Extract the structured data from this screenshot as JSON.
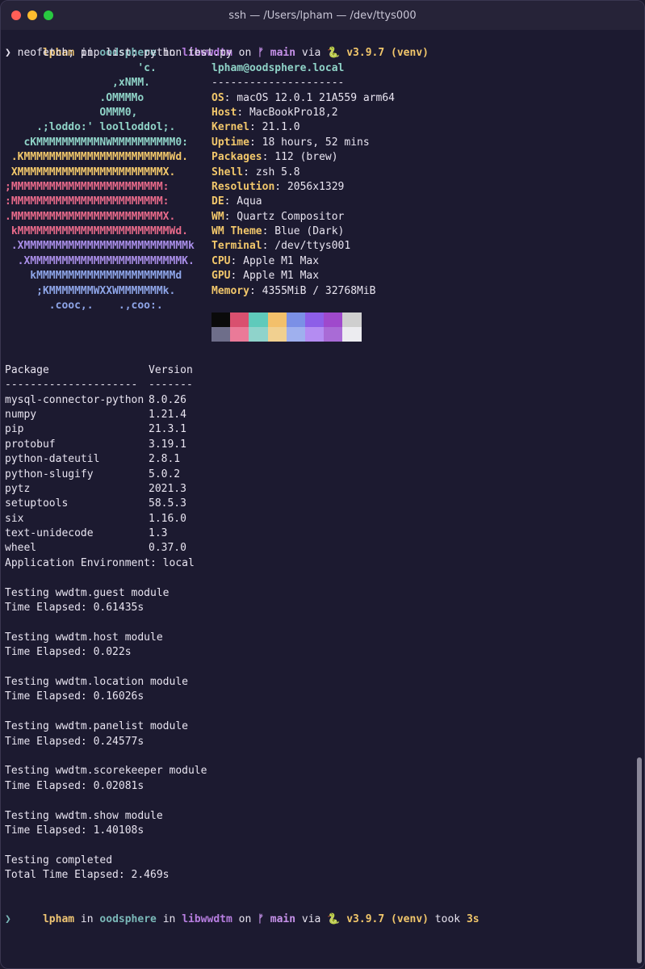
{
  "window": {
    "title": "ssh — /Users/lpham — /dev/ttys000",
    "lights": [
      "#ff5f57",
      "#febc2e",
      "#28c840"
    ]
  },
  "colors": {
    "user": "#f0c674",
    "host": "#7ab8b8",
    "dir": "#b77ee0",
    "branch": "#c792ea",
    "python": "#f2c76b",
    "label": "#f2c76b",
    "userhost": "#8fd3c7"
  },
  "prompt1": {
    "user": "lpham",
    "in1": " in ",
    "host": "oodsphere",
    "in2": " in ",
    "dir": "libwwdtm",
    "on": " on ",
    "branch_icon": "ᚠ",
    "branch": " main",
    "via": " via ",
    "python_icon": "🐍",
    "python": " v3.9.7 (venv)"
  },
  "command": "❯ neofetch; pip list; python test.py",
  "art": [
    {
      "text": "                     'c.",
      "color": "#8fd3c7"
    },
    {
      "text": "                 ,xNMM.",
      "color": "#8fd3c7"
    },
    {
      "text": "               .OMMMMo",
      "color": "#8fd3c7"
    },
    {
      "text": "               OMMM0,",
      "color": "#8fd3c7"
    },
    {
      "text": "     .;loddo:' loolloddol;.",
      "color": "#8fd3c7"
    },
    {
      "text": "   cKMMMMMMMMMMNWMMMMMMMMMM0:",
      "color": "#8fd3c7"
    },
    {
      "text": " .KMMMMMMMMMMMMMMMMMMMMMMMWd.",
      "color": "#f2c76b"
    },
    {
      "text": " XMMMMMMMMMMMMMMMMMMMMMMMX.",
      "color": "#f2c76b"
    },
    {
      "text": ";MMMMMMMMMMMMMMMMMMMMMMMM:",
      "color": "#e86a8a"
    },
    {
      "text": ":MMMMMMMMMMMMMMMMMMMMMMMM:",
      "color": "#e86a8a"
    },
    {
      "text": ".MMMMMMMMMMMMMMMMMMMMMMMMX.",
      "color": "#e86a8a"
    },
    {
      "text": " kMMMMMMMMMMMMMMMMMMMMMMMMWd.",
      "color": "#e86a8a"
    },
    {
      "text": " .XMMMMMMMMMMMMMMMMMMMMMMMMMMk",
      "color": "#a98ee8"
    },
    {
      "text": "  .XMMMMMMMMMMMMMMMMMMMMMMMMK.",
      "color": "#a98ee8"
    },
    {
      "text": "    kMMMMMMMMMMMMMMMMMMMMMMd",
      "color": "#8ea5e8"
    },
    {
      "text": "     ;KMMMMMMMWXXWMMMMMMMk.",
      "color": "#8ea5e8"
    },
    {
      "text": "       .cooc,.    .,coo:.",
      "color": "#8ea5e8"
    }
  ],
  "userhost": "lpham@oodsphere.local",
  "separator": "---------------------",
  "info": [
    {
      "label": "OS",
      "value": ": macOS 12.0.1 21A559 arm64"
    },
    {
      "label": "Host",
      "value": ": MacBookPro18,2"
    },
    {
      "label": "Kernel",
      "value": ": 21.1.0"
    },
    {
      "label": "Uptime",
      "value": ": 18 hours, 52 mins"
    },
    {
      "label": "Packages",
      "value": ": 112 (brew)"
    },
    {
      "label": "Shell",
      "value": ": zsh 5.8"
    },
    {
      "label": "Resolution",
      "value": ": 2056x1329"
    },
    {
      "label": "DE",
      "value": ": Aqua"
    },
    {
      "label": "WM",
      "value": ": Quartz Compositor"
    },
    {
      "label": "WM Theme",
      "value": ": Blue (Dark)"
    },
    {
      "label": "Terminal",
      "value": ": /dev/ttys001"
    },
    {
      "label": "CPU",
      "value": ": Apple M1 Max"
    },
    {
      "label": "GPU",
      "value": ": Apple M1 Max"
    },
    {
      "label": "Memory",
      "value": ": 4355MiB / 32768MiB"
    }
  ],
  "palette": [
    [
      "#0a0a0a",
      "#d9506f",
      "#5fcabb",
      "#f3c06b",
      "#7b90e6",
      "#8d5ee8",
      "#9f49cc",
      "#cfcfcf"
    ],
    [
      "#6e6e8a",
      "#ea7a98",
      "#8fd3cb",
      "#f1d090",
      "#9fb0ee",
      "#b48cf2",
      "#a96bd6",
      "#ececf0"
    ]
  ],
  "pip": {
    "header": [
      "Package",
      "Version"
    ],
    "divider": [
      "---------------------",
      "-------"
    ],
    "rows": [
      [
        "mysql-connector-python",
        "8.0.26"
      ],
      [
        "numpy",
        "1.21.4"
      ],
      [
        "pip",
        "21.3.1"
      ],
      [
        "protobuf",
        "3.19.1"
      ],
      [
        "python-dateutil",
        "2.8.1"
      ],
      [
        "python-slugify",
        "5.0.2"
      ],
      [
        "pytz",
        "2021.3"
      ],
      [
        "setuptools",
        "58.5.3"
      ],
      [
        "six",
        "1.16.0"
      ],
      [
        "text-unidecode",
        "1.3"
      ],
      [
        "wheel",
        "0.37.0"
      ]
    ]
  },
  "output": [
    "Application Environment: local",
    "",
    "Testing wwdtm.guest module",
    "Time Elapsed: 0.61435s",
    "",
    "Testing wwdtm.host module",
    "Time Elapsed: 0.022s",
    "",
    "Testing wwdtm.location module",
    "Time Elapsed: 0.16026s",
    "",
    "Testing wwdtm.panelist module",
    "Time Elapsed: 0.24577s",
    "",
    "Testing wwdtm.scorekeeper module",
    "Time Elapsed: 0.02081s",
    "",
    "Testing wwdtm.show module",
    "Time Elapsed: 1.40108s",
    "",
    "Testing completed",
    "Total Time Elapsed: 2.469s",
    ""
  ],
  "prompt2": {
    "user": "lpham",
    "in1": " in ",
    "host": "oodsphere",
    "in2": " in ",
    "dir": "libwwdtm",
    "on": " on ",
    "branch_icon": "ᚠ",
    "branch": " main",
    "via": " via ",
    "python_icon": "🐍",
    "python": " v3.9.7 (venv)",
    "took": " took ",
    "duration": "3s"
  },
  "cursor_prompt": "❯"
}
